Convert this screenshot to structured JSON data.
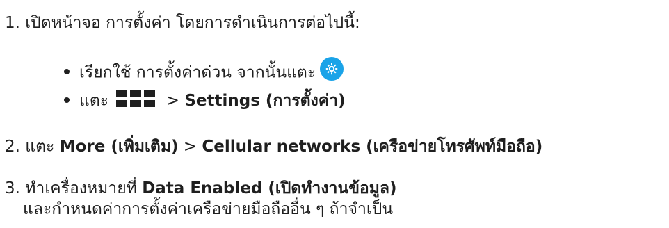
{
  "step1": {
    "number": "1.",
    "text": "เปิดหน้าจอ การตั้งค่า โดยการดำเนินการต่อไปนี้:",
    "bullet1": {
      "text": "เรียกใช้ การตั้งค่าด่วน จากนั้นแตะ",
      "icon": "gear-icon",
      "icon_color": "#1aa3e8"
    },
    "bullet2": {
      "prefix": "แตะ",
      "icon": "all-apps-grid-icon",
      "sep": ">",
      "bold": "Settings (การตั้งค่า)"
    }
  },
  "step2": {
    "number": "2.",
    "prefix": "แตะ",
    "bold1": "More (เพิ่มเติม)",
    "sep": ">",
    "bold2": "Cellular networks (เครือข่ายโทรศัพท์มือถือ)"
  },
  "step3": {
    "number": "3.",
    "prefix": "ทำเครื่องหมายที่",
    "bold": "Data Enabled (เปิดทำงานข้อมูล)",
    "line2": "และกำหนดค่าการตั้งค่าเครือข่ายมือถืออื่น ๆ ถ้าจำเป็น"
  }
}
